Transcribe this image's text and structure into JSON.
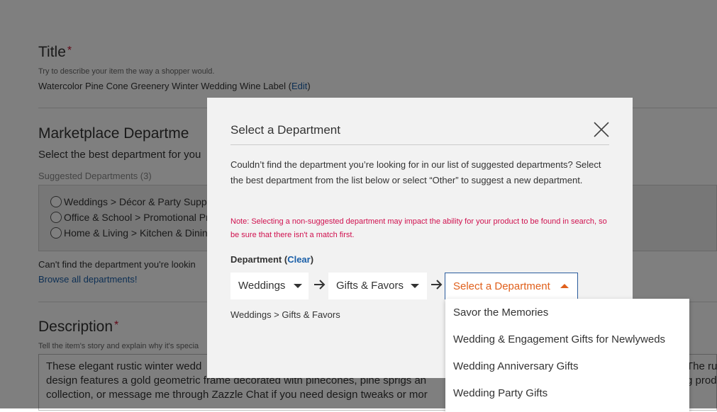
{
  "background_form": {
    "title_heading": "Title",
    "required_mark": "*",
    "title_hint": "Try to describe your item the way a shopper would.",
    "title_value": "Watercolor Pine Cone Greenery Winter Wedding Wine Label",
    "edit_open": "(",
    "edit_label": "Edit",
    "edit_close": ")",
    "marketplace_heading": "Marketplace Departme",
    "marketplace_sub": "Select the best department for you",
    "suggested_label": "Suggested Departments (3)",
    "suggested": [
      "Weddings > Décor & Party Suppli",
      "Office & School > Promotional Pr",
      "Home & Living > Kitchen & Dining"
    ],
    "cant_find": "Can't find the department you're lookin",
    "browse_all": "Browse all departments!",
    "description_heading": "Description",
    "description_hint": "Tell the item's story and explain why it's specia",
    "description_lines": [
      "These elegant rustic winter wedd",
      "design features a gold geometric frame decorated with pinecones, pine sprigs an",
      "collection, or message me through Zazzle Chat if you need design tweaks or mor"
    ],
    "description_right": [
      "The ru",
      "g prod"
    ]
  },
  "modal": {
    "title": "Select a Department",
    "close_icon": "close-x-icon",
    "body": "Couldn’t find the department you’re looking for in our list of suggested departments? Select the best department from the list below or select “Other” to suggest a new department.",
    "note": "Note: Selecting a non-suggested department may impact the ability for your product to be found in search, so be sure that there isn't a match first.",
    "department_label": "Department (",
    "clear_label": "Clear",
    "department_label_end": ")",
    "selects": [
      {
        "value": "Weddings"
      },
      {
        "value": "Gifts & Favors"
      },
      {
        "value": "Select a Department",
        "open": true
      }
    ],
    "breadcrumb": "Weddings > Gifts & Favors",
    "dropdown_options": [
      "Savor the Memories",
      "Wedding & Engagement Gifts for Newlyweds",
      "Wedding Anniversary Gifts",
      "Wedding Party Gifts"
    ]
  },
  "colors": {
    "accent_orange": "#e0601c",
    "link_blue": "#1a5fa8",
    "note_red": "#d0114f",
    "required_red": "#c41230"
  }
}
